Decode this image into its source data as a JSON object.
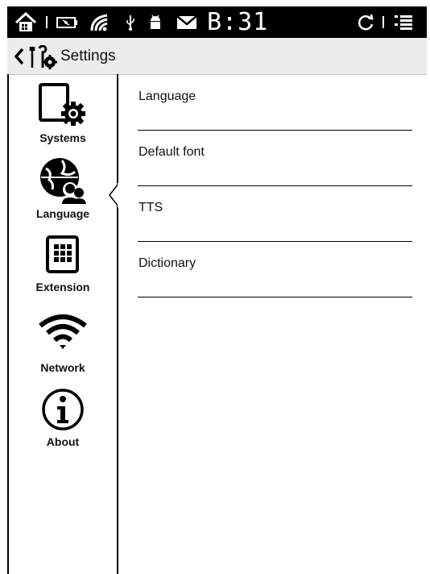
{
  "status_bar": {
    "clock": "B:31",
    "icons": [
      "home-icon",
      "battery-icon",
      "wifi-signal-icon",
      "usb-icon",
      "android-icon",
      "notification-icon",
      "refresh-icon",
      "menu-icon"
    ]
  },
  "title_bar": {
    "title": "Settings",
    "icons": [
      "back-chevron-icon",
      "settings-tools-icon"
    ]
  },
  "sidebar": {
    "items": [
      {
        "label": "Systems",
        "icon": "system-settings-icon"
      },
      {
        "label": "Language",
        "icon": "language-globe-icon",
        "selected": true
      },
      {
        "label": "Extension",
        "icon": "extension-keypad-icon"
      },
      {
        "label": "Network",
        "icon": "wifi-icon"
      },
      {
        "label": "About",
        "icon": "info-icon"
      }
    ]
  },
  "content": {
    "items": [
      {
        "label": "Language"
      },
      {
        "label": "Default font"
      },
      {
        "label": "TTS"
      },
      {
        "label": "Dictionary"
      }
    ]
  },
  "colors": {
    "status_bar_bg": "#000000",
    "title_bar_bg": "#ececec",
    "page_bg": "#ffffff",
    "text": "#111111"
  }
}
